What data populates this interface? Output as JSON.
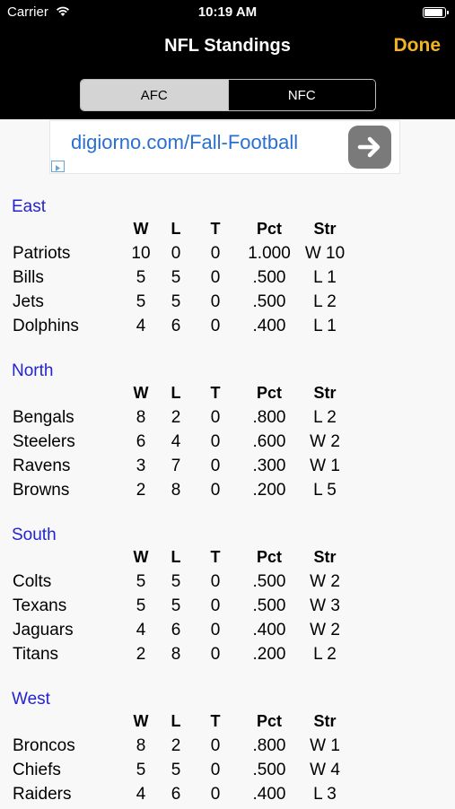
{
  "status_bar": {
    "carrier": "Carrier",
    "time": "10:19 AM"
  },
  "nav": {
    "title": "NFL Standings",
    "done_label": "Done"
  },
  "segments": {
    "afc": "AFC",
    "nfc": "NFC",
    "selected": "AFC"
  },
  "ad": {
    "text": "digiorno.com/Fall-Football"
  },
  "columns": {
    "w": "W",
    "l": "L",
    "t": "T",
    "pct": "Pct",
    "str": "Str"
  },
  "divisions": [
    {
      "name": "East",
      "teams": [
        {
          "team": "Patriots",
          "w": "10",
          "l": "0",
          "t": "0",
          "pct": "1.000",
          "str": "W 10"
        },
        {
          "team": "Bills",
          "w": "5",
          "l": "5",
          "t": "0",
          "pct": ".500",
          "str": "L 1"
        },
        {
          "team": "Jets",
          "w": "5",
          "l": "5",
          "t": "0",
          "pct": ".500",
          "str": "L 2"
        },
        {
          "team": "Dolphins",
          "w": "4",
          "l": "6",
          "t": "0",
          "pct": ".400",
          "str": "L 1"
        }
      ]
    },
    {
      "name": "North",
      "teams": [
        {
          "team": "Bengals",
          "w": "8",
          "l": "2",
          "t": "0",
          "pct": ".800",
          "str": "L 2"
        },
        {
          "team": "Steelers",
          "w": "6",
          "l": "4",
          "t": "0",
          "pct": ".600",
          "str": "W 2"
        },
        {
          "team": "Ravens",
          "w": "3",
          "l": "7",
          "t": "0",
          "pct": ".300",
          "str": "W 1"
        },
        {
          "team": "Browns",
          "w": "2",
          "l": "8",
          "t": "0",
          "pct": ".200",
          "str": "L 5"
        }
      ]
    },
    {
      "name": "South",
      "teams": [
        {
          "team": "Colts",
          "w": "5",
          "l": "5",
          "t": "0",
          "pct": ".500",
          "str": "W 2"
        },
        {
          "team": "Texans",
          "w": "5",
          "l": "5",
          "t": "0",
          "pct": ".500",
          "str": "W 3"
        },
        {
          "team": "Jaguars",
          "w": "4",
          "l": "6",
          "t": "0",
          "pct": ".400",
          "str": "W 2"
        },
        {
          "team": "Titans",
          "w": "2",
          "l": "8",
          "t": "0",
          "pct": ".200",
          "str": "L 2"
        }
      ]
    },
    {
      "name": "West",
      "teams": [
        {
          "team": "Broncos",
          "w": "8",
          "l": "2",
          "t": "0",
          "pct": ".800",
          "str": "W 1"
        },
        {
          "team": "Chiefs",
          "w": "5",
          "l": "5",
          "t": "0",
          "pct": ".500",
          "str": "W 4"
        },
        {
          "team": "Raiders",
          "w": "4",
          "l": "6",
          "t": "0",
          "pct": ".400",
          "str": "L 3"
        }
      ]
    }
  ]
}
